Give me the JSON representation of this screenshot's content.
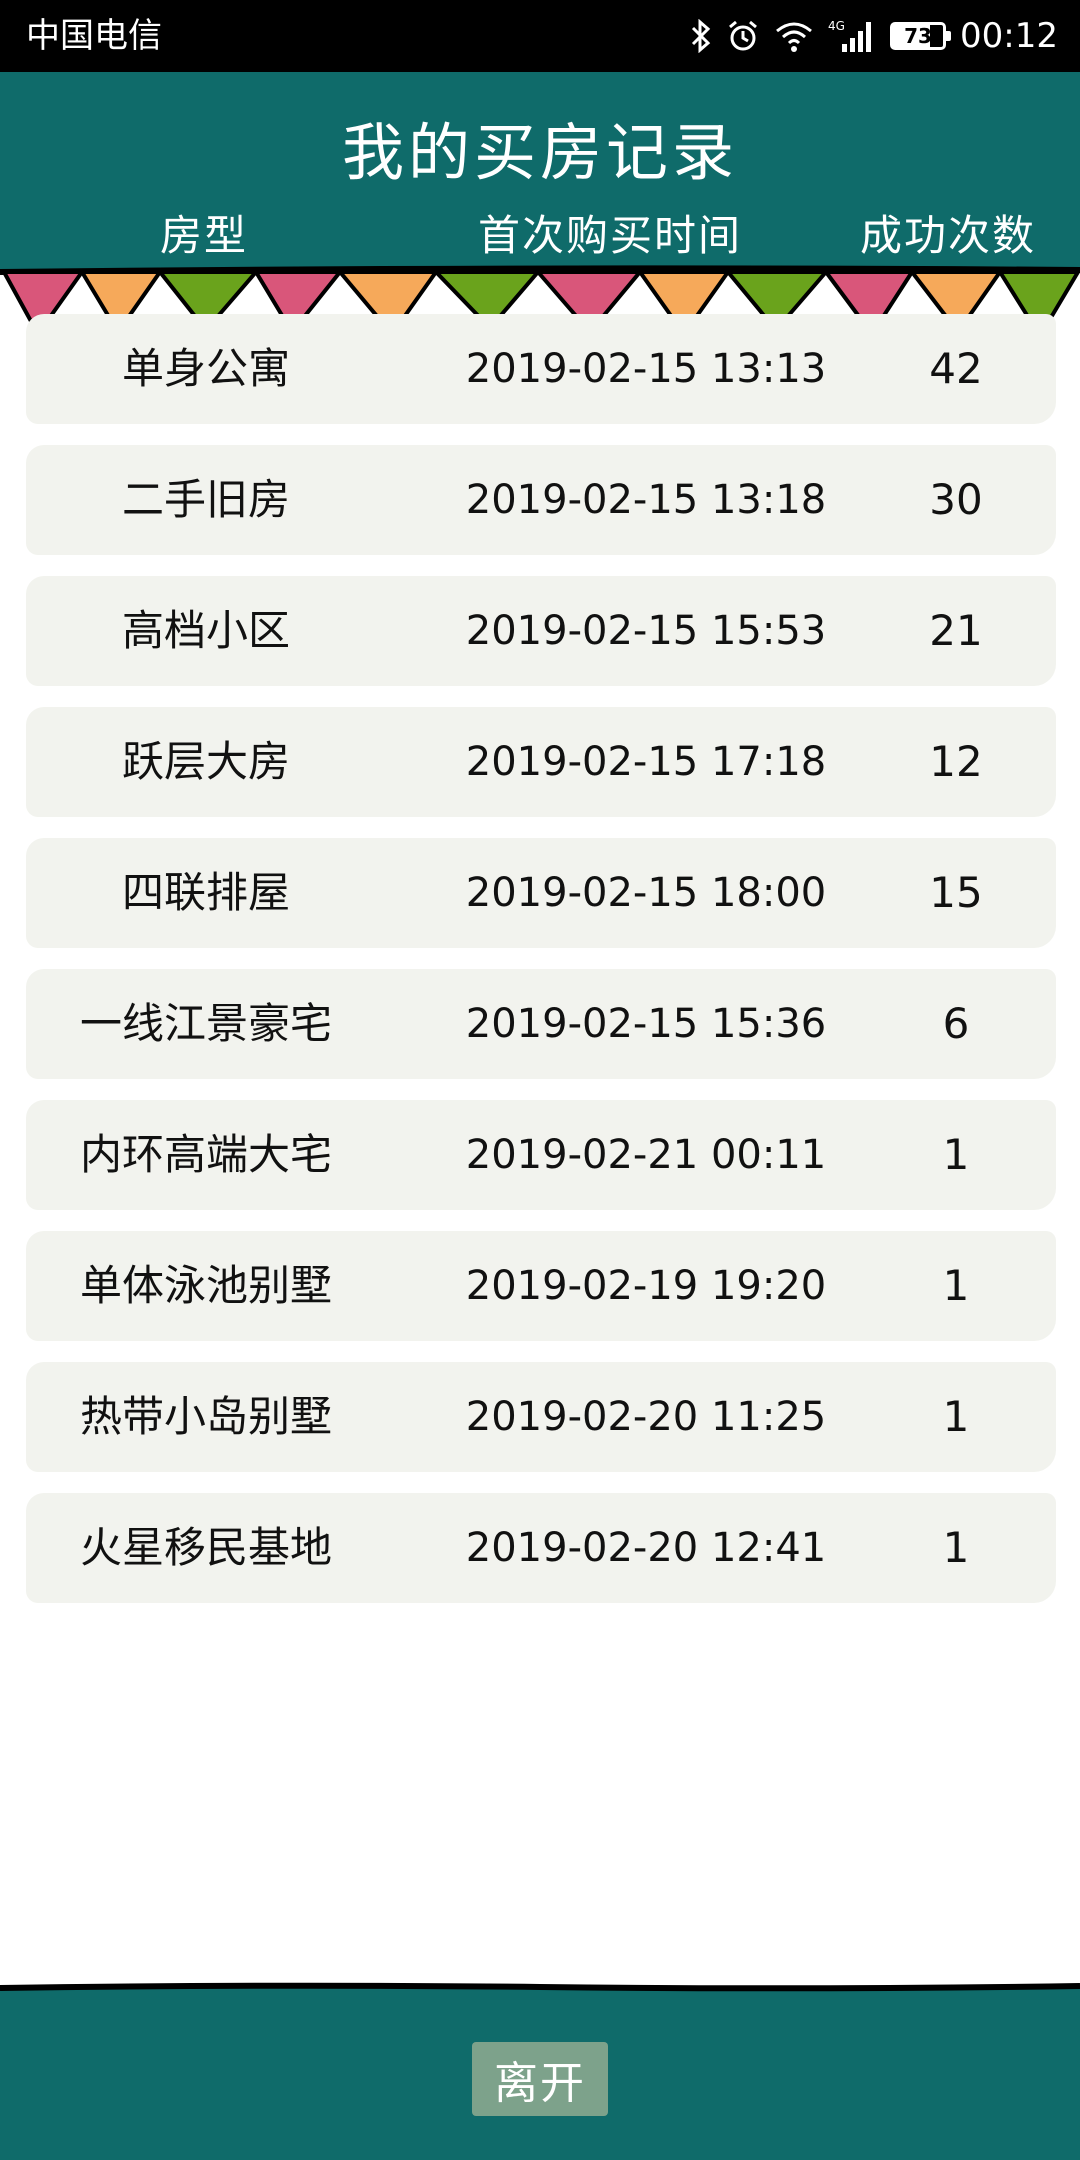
{
  "status": {
    "carrier": "中国电信",
    "network": "4G",
    "battery": "73",
    "time": "00:12",
    "icons": [
      "bluetooth-icon",
      "alarm-icon",
      "wifi-icon",
      "signal-icon",
      "battery-icon"
    ]
  },
  "header": {
    "title": "我的买房记录",
    "columns": [
      "房型",
      "首次购买时间",
      "成功次数"
    ]
  },
  "records": [
    {
      "type": "单身公寓",
      "time": "2019-02-15 13:13",
      "count": "42"
    },
    {
      "type": "二手旧房",
      "time": "2019-02-15 13:18",
      "count": "30"
    },
    {
      "type": "高档小区",
      "time": "2019-02-15 15:53",
      "count": "21"
    },
    {
      "type": "跃层大房",
      "time": "2019-02-15 17:18",
      "count": "12"
    },
    {
      "type": "四联排屋",
      "time": "2019-02-15 18:00",
      "count": "15"
    },
    {
      "type": "一线江景豪宅",
      "time": "2019-02-15 15:36",
      "count": "6"
    },
    {
      "type": "内环高端大宅",
      "time": "2019-02-21 00:11",
      "count": "1"
    },
    {
      "type": "单体泳池别墅",
      "time": "2019-02-19 19:20",
      "count": "1"
    },
    {
      "type": "热带小岛别墅",
      "time": "2019-02-20 11:25",
      "count": "1"
    },
    {
      "type": "火星移民基地",
      "time": "2019-02-20 12:41",
      "count": "1"
    }
  ],
  "footer": {
    "leave_label": "离开"
  },
  "colors": {
    "header_bg": "#0f6b6a",
    "row_bg": "#f2f3ee",
    "button_bg": "#7da28b",
    "flag_pink": "#d9567a",
    "flag_orange": "#f6a95a",
    "flag_green": "#6aa31c"
  }
}
